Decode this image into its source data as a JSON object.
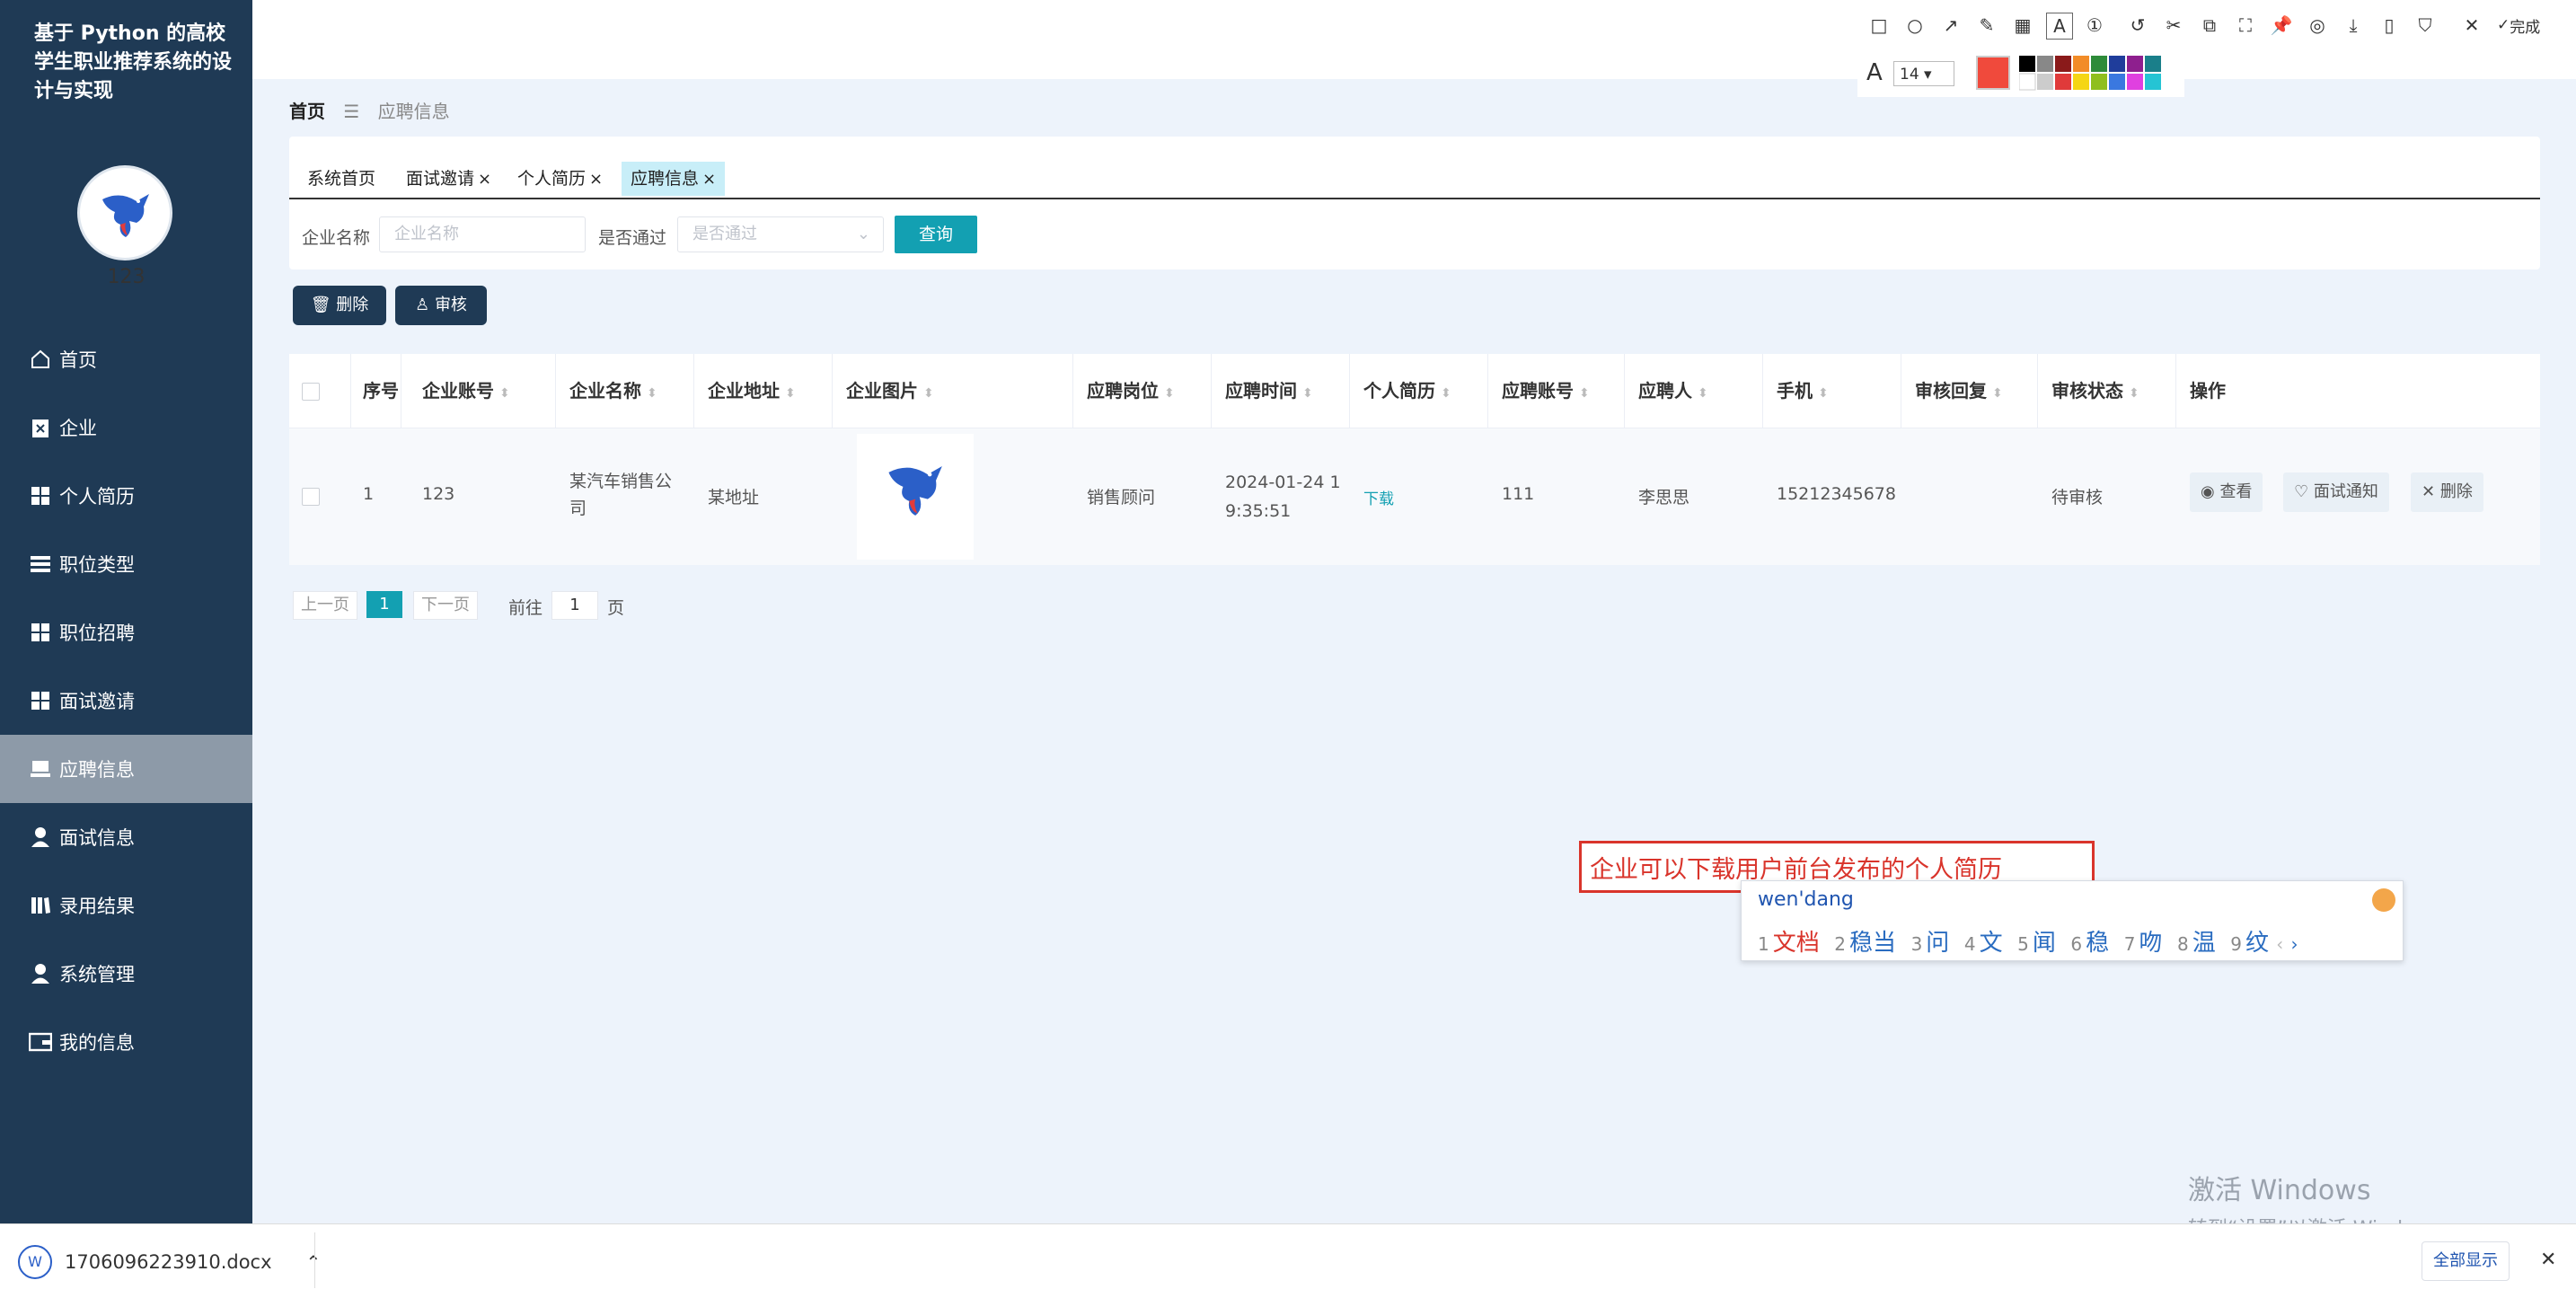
{
  "app": {
    "title": "基于 Python 的高校学生职业推荐系统的设计与实现",
    "username": "123"
  },
  "sidebar": {
    "items": [
      {
        "label": "首页",
        "icon": "home-icon"
      },
      {
        "label": "企业",
        "icon": "clipboard-icon"
      },
      {
        "label": "个人简历",
        "icon": "grid-icon"
      },
      {
        "label": "职位类型",
        "icon": "list-icon"
      },
      {
        "label": "职位招聘",
        "icon": "grid-icon"
      },
      {
        "label": "面试邀请",
        "icon": "grid-icon"
      },
      {
        "label": "应聘信息",
        "icon": "stack-icon",
        "active": true
      },
      {
        "label": "面试信息",
        "icon": "user-icon"
      },
      {
        "label": "录用结果",
        "icon": "book-icon"
      },
      {
        "label": "系统管理",
        "icon": "user-icon"
      },
      {
        "label": "我的信息",
        "icon": "wallet-icon"
      }
    ]
  },
  "breadcrumb": {
    "home": "首页",
    "sep": "☰",
    "current": "应聘信息"
  },
  "tabs": [
    {
      "label": "系统首页",
      "closable": false
    },
    {
      "label": "面试邀请",
      "closable": true
    },
    {
      "label": "个人简历",
      "closable": true
    },
    {
      "label": "应聘信息",
      "closable": true,
      "active": true
    }
  ],
  "search": {
    "company_label": "企业名称",
    "company_placeholder": "企业名称",
    "passed_label": "是否通过",
    "passed_placeholder": "是否通过",
    "query_button": "查询"
  },
  "actions": {
    "delete": "删除",
    "audit": "审核"
  },
  "table": {
    "columns": [
      "序号",
      "企业账号",
      "企业名称",
      "企业地址",
      "企业图片",
      "应聘岗位",
      "应聘时间",
      "个人简历",
      "应聘账号",
      "应聘人",
      "手机",
      "审核回复",
      "审核状态",
      "操作"
    ],
    "rows": [
      {
        "index": "1",
        "company_account": "123",
        "company_name": "某汽车销售公司",
        "company_address": "某地址",
        "position": "销售顾问",
        "apply_time": "2024-01-24 19:35:51",
        "resume": "下载",
        "apply_account": "111",
        "applicant": "李思思",
        "phone": "15212345678",
        "audit_reply": "",
        "audit_status": "待审核",
        "ops": {
          "view": "查看",
          "notify": "面试通知",
          "delete": "删除"
        }
      }
    ]
  },
  "pager": {
    "prev": "上一页",
    "current": "1",
    "next": "下一页",
    "goto": "前往",
    "page_value": "1",
    "page_unit": "页"
  },
  "screenshot_tool": {
    "font_size": "14",
    "done": "完成",
    "accent": "#f04a3c"
  },
  "annotation": {
    "text": "企业可以下载用户前台发布的个人简历"
  },
  "ime": {
    "pinyin": "wen'dang",
    "candidates": [
      "文档",
      "稳当",
      "问",
      "文",
      "闻",
      "稳",
      "吻",
      "温",
      "纹"
    ]
  },
  "windows_activation": {
    "line1": "激活 Windows",
    "line2": "转到“设置”以激活 Windows。"
  },
  "download_bar": {
    "file_name": "1706096223910.docx",
    "show_all": "全部显示"
  }
}
